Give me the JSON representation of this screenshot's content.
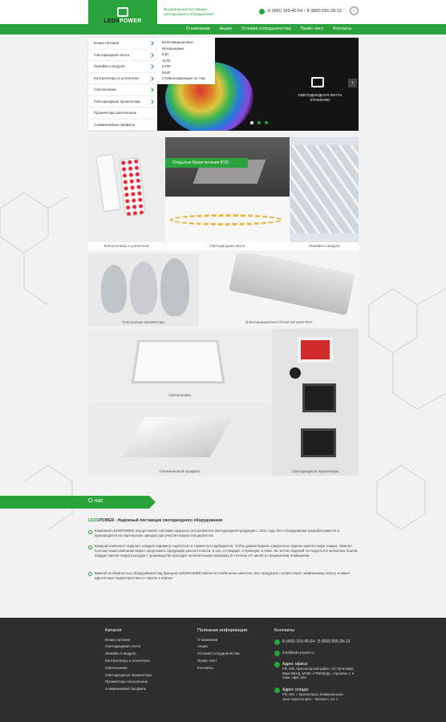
{
  "header": {
    "logo_prefix": "LEDS",
    "logo_suffix": "POWER",
    "tagline": "Федеральный поставщик светодиодного оборудования",
    "phone1": "8 (495) 150-40-54",
    "phone_sep": "/",
    "phone2": "8 (800) 555-28-13"
  },
  "nav": {
    "items": [
      "О компании",
      "Акции",
      "Условия сотрудничества",
      "Прайс-лист",
      "Контакты"
    ]
  },
  "catalog_menu": {
    "items": [
      "Блоки питания",
      "Светодиодная лента",
      "Линейки и модули",
      "Контроллеры и усилители",
      "Светильники",
      "Светодиодные прожекторы",
      "Прожекторы консольные",
      "Алюминиевый профиль"
    ]
  },
  "submenu": {
    "items": [
      "Влагозащищенные",
      "Интерьерные",
      "5 Вт",
      "12 Вт",
      "24 Вт",
      "48 Вт",
      "Стабилизирующие по току"
    ]
  },
  "banner": {
    "title": "СВЕТОДИОДНАЯ ЛЕНТА",
    "subtitle": "STANDARD",
    "next_arrow": "›"
  },
  "tiles": {
    "controllers": "Контроллеры и усилители",
    "ribbon": "Открытые блоки питания IP20",
    "led_strip": "Светодиодная лента",
    "lines": "Линейки и модули",
    "console": "Консольные прожекторы",
    "waterproof": "Влагозащищенные блоки питания IP67",
    "lamps": "Светильники",
    "profile": "Алюминиевый профиль",
    "floodlights": "Светодиодные прожекторы"
  },
  "about": {
    "title": "О нас",
    "brand_prefix": "LEDS",
    "brand_suffix": "POWER",
    "subtitle": " - Надежный поставщик светодиодного оборудования",
    "p1": "Компания LEDSPOWER осуществляет поставки широкого ассортимента светодиодной продукции с 2011 года. Все оборудование разрабатывается и производится на партнерских заводах при участии наших специалистов.",
    "p2": "Каждый компонент изделия, каждый параметр тщательно и совместно подбирается, чтобы удовлетворить конкретные задачи нужного вида товара. Именно поэтому наша компания может предложить продукцию разного класса: и эко, и стандарт, и премиум, и люкс. Ка чество изделий тестируется в несколько этапов. Каждая партия перед выходом с производства проходит окончательную проверку (в течение 24 часов) в специальном помещении.",
    "p3": "Важной особенностью оборудования под брендом LEDSPOWER является стабильное качество. Все продукция соответствует заявленному классу и имеет идентичные характеристики от партии к партии."
  },
  "footer": {
    "catalog_title": "Каталог",
    "catalog": [
      "Блоки питания",
      "Светодиодная лента",
      "Линейки и модули",
      "Контроллеры и усилители",
      "Светильники",
      "Светодиодные прожекторы",
      "Прожекторы консольные",
      "Алюминиевый профиль"
    ],
    "info_title": "Полезная информация",
    "info": [
      "О компании",
      "Акции",
      "Условия сотрудничества",
      "Прайс-лист",
      "Контакты"
    ],
    "contacts_title": "Контакты",
    "phone1": "8 (495) 150-40-54",
    "phone_sep": "/",
    "phone2": "8 (800) 555-28-13",
    "email": "info@leds-power.ru",
    "office_title": "Адрес офиса:",
    "office_address": "РФ, МО, Красногорский район, п/о Путилково, 69км МКАД, МТВК «ГРИНВУД», строение 1, 6 этаж, офис 204",
    "warehouse_title": "Адрес склада:",
    "warehouse_address": "РФ, МО, г. Красногорск, Коммунальная зона «Красногорск – Митино», вл. 2"
  }
}
